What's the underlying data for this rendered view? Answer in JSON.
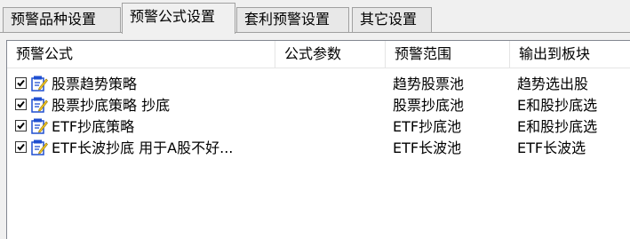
{
  "tabs": [
    {
      "label": "预警品种设置",
      "active": false
    },
    {
      "label": "预警公式设置",
      "active": true
    },
    {
      "label": "套利预警设置",
      "active": false
    },
    {
      "label": "其它设置",
      "active": false
    }
  ],
  "table": {
    "columns": [
      "预警公式",
      "公式参数",
      "预警范围",
      "输出到板块"
    ],
    "rows": [
      {
        "checked": true,
        "formula": "股票趋势策略",
        "params": "",
        "range": "趋势股票池",
        "output": "趋势选出股"
      },
      {
        "checked": true,
        "formula": "股票抄底策略 抄底",
        "params": "",
        "range": "股票抄底池",
        "output": "E和股抄底选"
      },
      {
        "checked": true,
        "formula": "ETF抄底策略",
        "params": "",
        "range": "ETF抄底池",
        "output": "E和股抄底选"
      },
      {
        "checked": true,
        "formula": "ETF长波抄底 用于A股不好...",
        "params": "",
        "range": "ETF长波池",
        "output": "ETF长波选"
      }
    ]
  },
  "icons": {
    "row_icon": "formula-edit-icon",
    "checkbox": "checkmark-icon"
  },
  "colors": {
    "icon_blue": "#1f4fd1",
    "icon_yellow": "#f3c623",
    "list_bg": "#ffffff",
    "window_bg": "#f0f0f0"
  }
}
